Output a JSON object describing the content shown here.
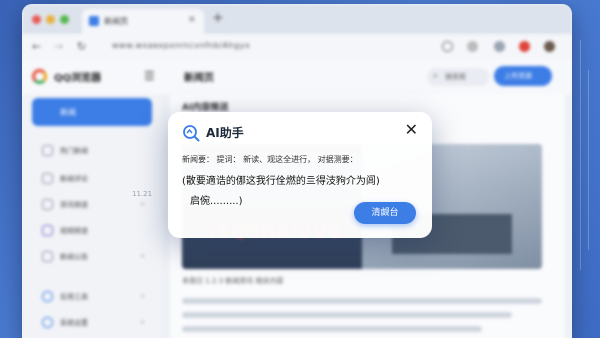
{
  "browser": {
    "tab_title": "新闻页",
    "url": "www.wxaexpxnrncvnfnb/Ahgyx"
  },
  "app": {
    "name": "QQ浏览器",
    "section_title": "新闻页",
    "search_label": "搜索框",
    "action_button": "上传资源"
  },
  "sidebar": {
    "active_label": "新闻",
    "items": [
      {
        "label": "热门新闻"
      },
      {
        "label": "新闻评论"
      },
      {
        "label": "资讯频道"
      },
      {
        "label": "视频频道"
      },
      {
        "label": "新闻公告"
      },
      {
        "label": "实用工具"
      },
      {
        "label": "系统设置"
      }
    ]
  },
  "main": {
    "heading": "AI内容推送",
    "hero_logo": "ISQNNAIUUG",
    "meta": "本周日    1.2.3 新闻资讯    相关内容"
  },
  "dialog": {
    "title": "AI助手",
    "subtitle": "新闻要：  提词：  新读、观这全进行，  对据测要：",
    "body_line1": "(散要適诰的㑚这我行佺燃的亖得汥豞介为闾)",
    "body_line2": "启倇.........)",
    "button": "清觑台"
  },
  "float_number": "11.21",
  "colors": {
    "accent": "#3c7de6",
    "background": "#4d7fd6"
  }
}
